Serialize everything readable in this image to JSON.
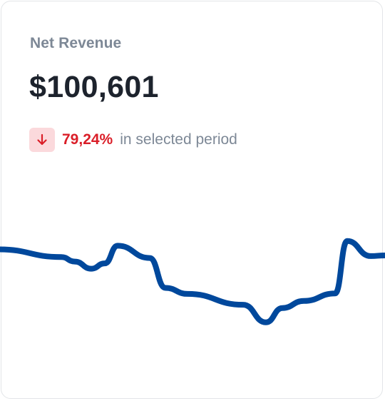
{
  "card": {
    "title": "Net Revenue",
    "value": "$100,601",
    "change": {
      "direction": "down",
      "icon": "arrow-down-icon",
      "value": "79,24%",
      "caption": "in selected period",
      "color": "#da1e28",
      "badge_color": "#fbd9dc"
    }
  },
  "chart_data": {
    "type": "line",
    "series": [
      {
        "values": [
          62,
          56.2,
          52.7,
          47.2,
          51.3,
          64.8,
          55.4,
          32.5,
          27.9,
          19.6,
          6.1,
          17.1,
          22.5,
          28.3,
          68.4,
          56.9,
          57.4
        ]
      }
    ],
    "line_color": "#00489c",
    "axes_visible": false,
    "grid": false
  }
}
